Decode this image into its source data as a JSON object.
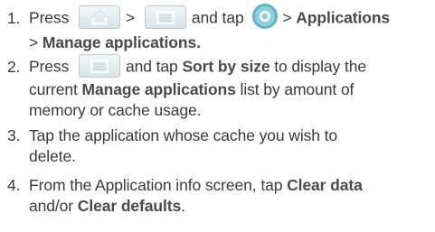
{
  "steps": [
    {
      "number": "1.",
      "t_press": "Press",
      "t_gt1": ">",
      "t_and_tap": "and tap",
      "t_gt2": ">",
      "b_applications": "Applications",
      "t_gt3": ">",
      "b_manage": "Manage applications."
    },
    {
      "number": "2.",
      "t_press": "Press",
      "t_and_tap": "and tap",
      "b_sort": "Sort by size",
      "t_rest1": "to display the",
      "t_current": "current",
      "b_manage": "Manage applications",
      "t_list": "list by amount of",
      "t_memory": "memory or cache usage."
    },
    {
      "number": "3.",
      "line1": "Tap the application whose cache you wish to",
      "line2": "delete."
    },
    {
      "number": "4.",
      "t_from": "From the Application info screen, tap",
      "b_clear_data": "Clear data",
      "t_and_or": "and/or",
      "b_clear_defaults": "Clear defaults",
      "t_period": "."
    }
  ],
  "icons": {
    "home": "home-key-icon",
    "menu": "menu-key-icon",
    "apps": "launcher-icon"
  }
}
